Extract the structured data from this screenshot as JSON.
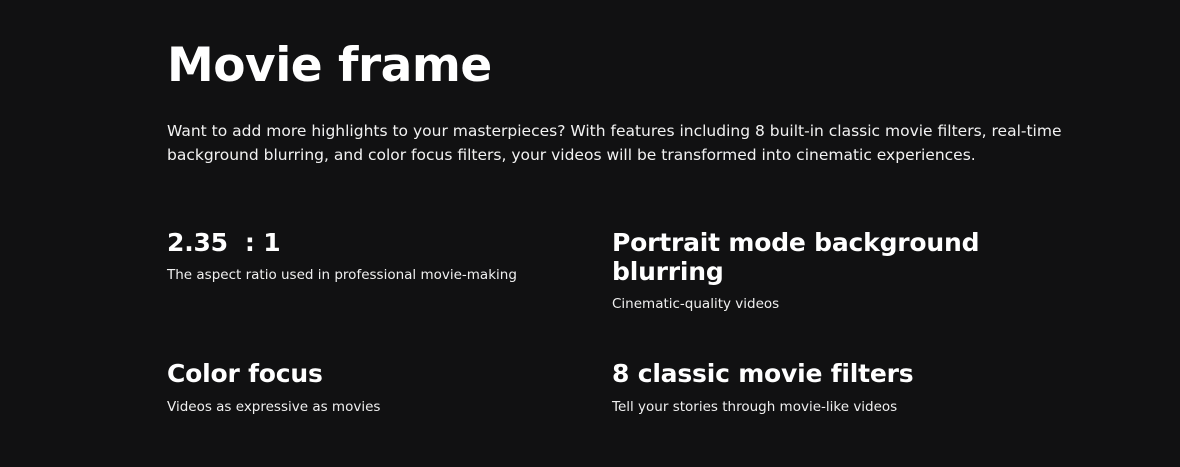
{
  "section": {
    "title": "Movie frame",
    "intro": "Want to add more highlights to your masterpieces? With features including 8 built-in classic movie filters, real-time background blurring, and color focus filters, your videos will be transformed into cinematic experiences."
  },
  "features": [
    {
      "title": "2.35  : 1",
      "subtitle": "The aspect ratio used in professional movie-making"
    },
    {
      "title": "Portrait mode background blurring",
      "subtitle": "Cinematic-quality videos"
    },
    {
      "title": "Color focus",
      "subtitle": "Videos as expressive as movies"
    },
    {
      "title": "8 classic movie filters",
      "subtitle": "Tell your stories through movie-like videos"
    }
  ],
  "colors": {
    "background": "#111112",
    "text": "#ffffff"
  }
}
